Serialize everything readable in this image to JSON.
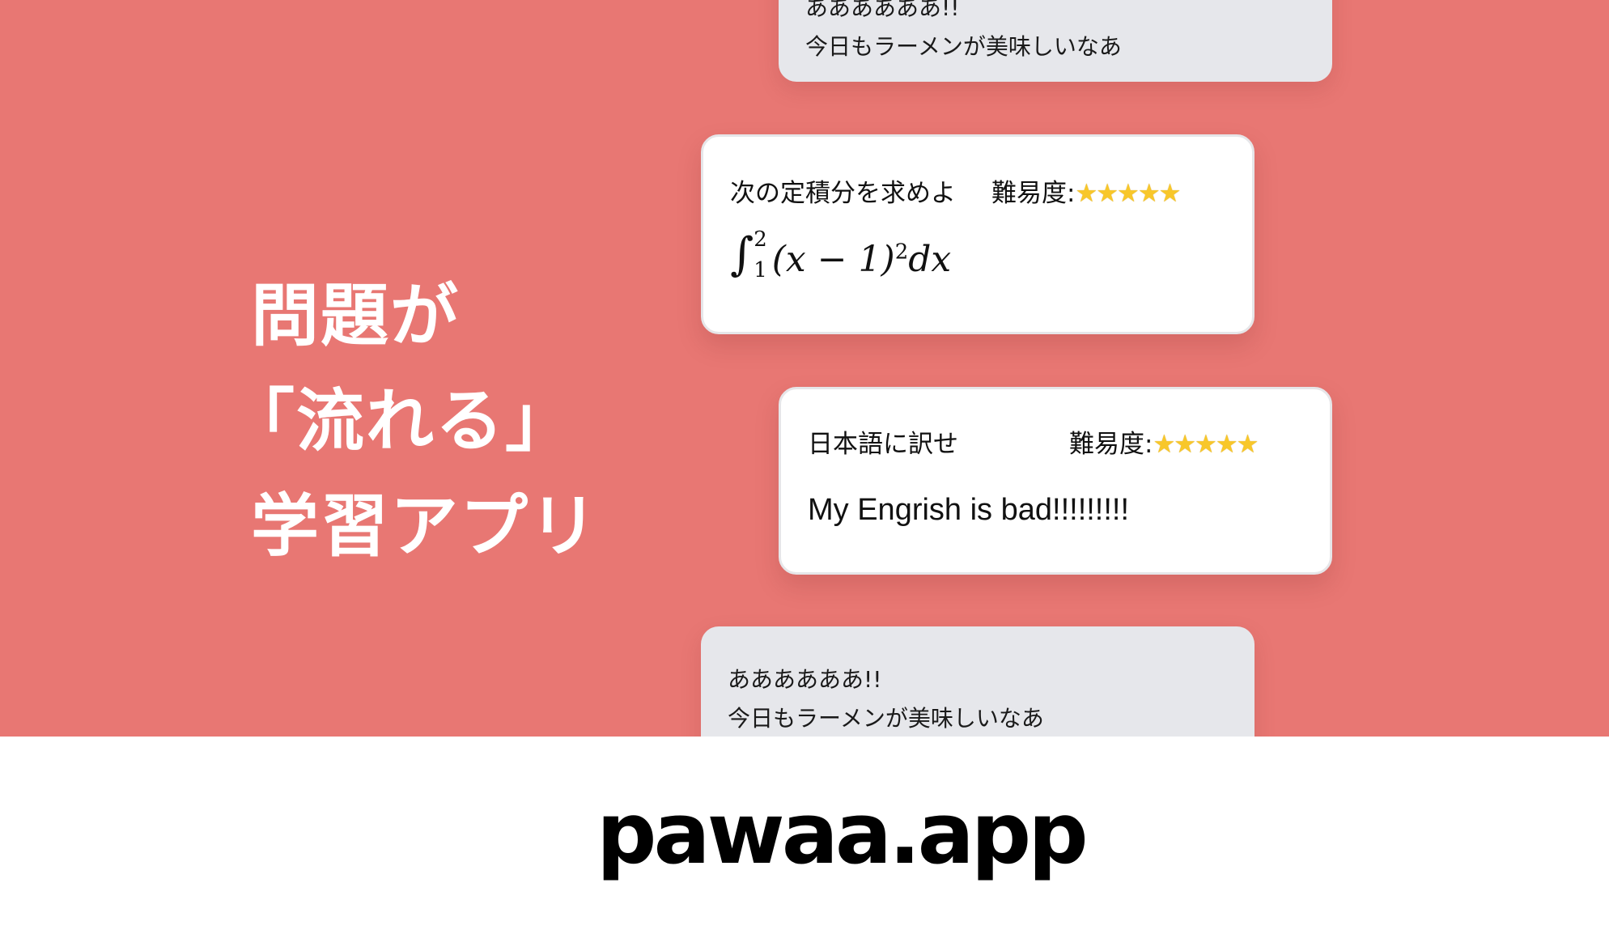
{
  "hero": {
    "headline_lines": [
      "問題が",
      "「流れる」",
      "学習アプリ"
    ],
    "background_color": "#e87773"
  },
  "cards": {
    "top_grey": {
      "line1": "ああああああ!!",
      "line2": "今日もラーメンが美味しいなあ"
    },
    "integral": {
      "prompt": "次の定積分を求めよ",
      "difficulty_label": "難易度:",
      "stars": "★★★★★",
      "math": {
        "lower": "1",
        "upper": "2",
        "expression": "(x − 1)",
        "power": "2",
        "differential": "dx"
      }
    },
    "translate": {
      "prompt": "日本語に訳せ",
      "difficulty_label": "難易度:",
      "stars": "★★★★★",
      "sentence": "My Engrish is bad!!!!!!!!!"
    },
    "bottom_grey": {
      "line1": "ああああああ!!",
      "line2": "今日もラーメンが美味しいなあ"
    }
  },
  "footer": {
    "logo_text": "pawaa.app"
  }
}
